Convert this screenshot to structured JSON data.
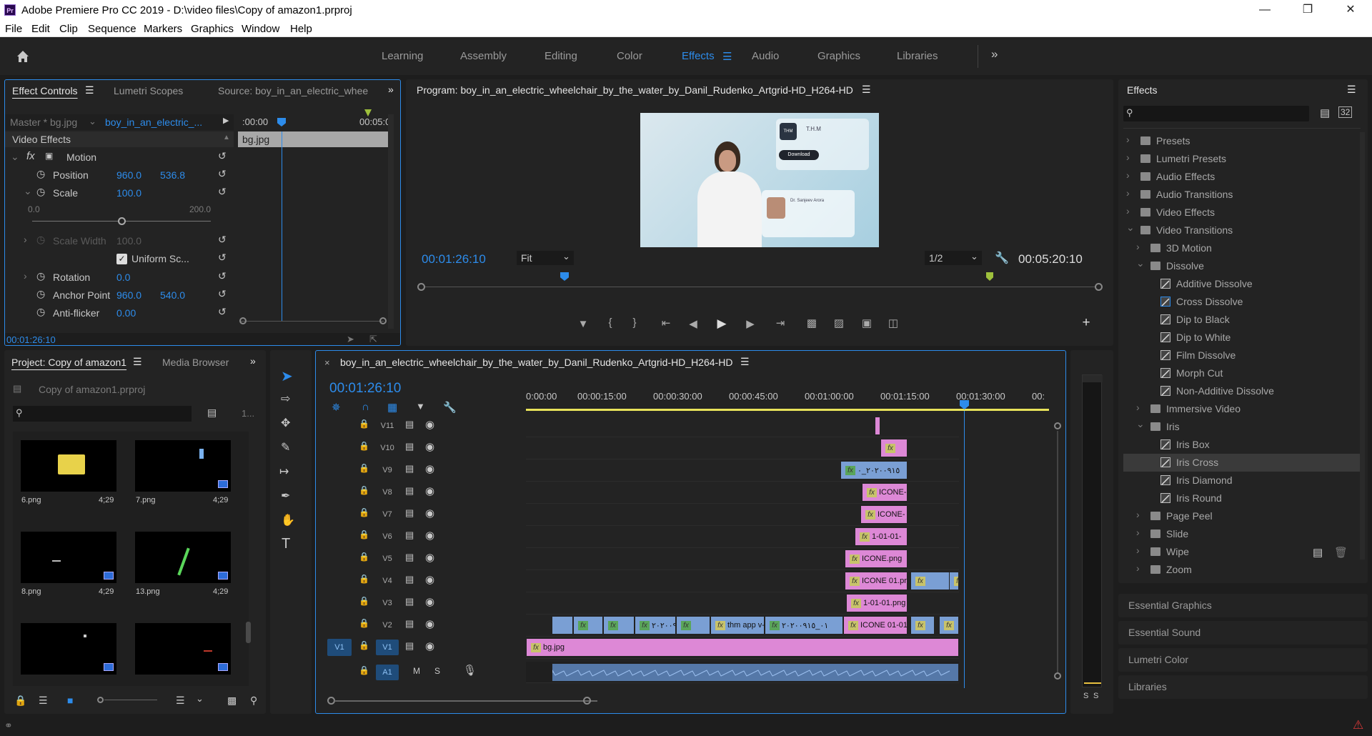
{
  "app": {
    "title": "Adobe Premiere Pro CC 2019 - D:\\video files\\Copy of amazon1.prproj",
    "logo": "Pr",
    "menu": [
      "File",
      "Edit",
      "Clip",
      "Sequence",
      "Markers",
      "Graphics",
      "Window",
      "Help"
    ],
    "window_controls": [
      "minimize-icon",
      "maximize-icon",
      "close-icon"
    ]
  },
  "workspaces": {
    "items": [
      "Learning",
      "Assembly",
      "Editing",
      "Color",
      "Effects",
      "Audio",
      "Graphics",
      "Libraries"
    ],
    "active": "Effects",
    "more": "»"
  },
  "effect_controls": {
    "tabs": [
      "Effect Controls",
      "Lumetri Scopes",
      "Source: boy_in_an_electric_whee"
    ],
    "master": "Master * bg.jpg",
    "clip": "boy_in_an_electric_...",
    "ruler_start": ":00:00",
    "ruler_end": "00:05:0",
    "clip_bar": "bg.jpg",
    "section": "Video Effects",
    "motion": "Motion",
    "props": {
      "position_label": "Position",
      "position_x": "960.0",
      "position_y": "536.8",
      "scale_label": "Scale",
      "scale_value": "100.0",
      "slider_min": "0.0",
      "slider_max": "200.0",
      "scale_width_label": "Scale Width",
      "scale_width_value": "100.0",
      "uniform_label": "Uniform Sc...",
      "rotation_label": "Rotation",
      "rotation_value": "0.0",
      "anchor_label": "Anchor Point",
      "anchor_x": "960.0",
      "anchor_y": "540.0",
      "flicker_label": "Anti-flicker",
      "flicker_value": "0.00"
    },
    "timecode": "00:01:26:10"
  },
  "program": {
    "title": "Program: boy_in_an_electric_wheelchair_by_the_water_by_Danil_Rudenko_Artgrid-HD_H264-HD",
    "timecode": "00:01:26:10",
    "fit": "Fit",
    "resolution": "1/2",
    "duration": "00:05:20:10",
    "frame": {
      "brand": "T.H.M",
      "download": "Download",
      "doctor": "Dr. Sanjeev Arora"
    }
  },
  "effects_panel": {
    "title": "Effects",
    "search_placeholder": "",
    "tree": [
      {
        "label": "Presets",
        "level": 0,
        "type": "folder",
        "open": false
      },
      {
        "label": "Lumetri Presets",
        "level": 0,
        "type": "folder",
        "open": false
      },
      {
        "label": "Audio Effects",
        "level": 0,
        "type": "folder",
        "open": false
      },
      {
        "label": "Audio Transitions",
        "level": 0,
        "type": "folder",
        "open": false
      },
      {
        "label": "Video Effects",
        "level": 0,
        "type": "folder",
        "open": false
      },
      {
        "label": "Video Transitions",
        "level": 0,
        "type": "folder",
        "open": true
      },
      {
        "label": "3D Motion",
        "level": 1,
        "type": "folder",
        "open": false
      },
      {
        "label": "Dissolve",
        "level": 1,
        "type": "folder",
        "open": true
      },
      {
        "label": "Additive Dissolve",
        "level": 2,
        "type": "fx"
      },
      {
        "label": "Cross Dissolve",
        "level": 2,
        "type": "fx",
        "default": true
      },
      {
        "label": "Dip to Black",
        "level": 2,
        "type": "fx"
      },
      {
        "label": "Dip to White",
        "level": 2,
        "type": "fx"
      },
      {
        "label": "Film Dissolve",
        "level": 2,
        "type": "fx"
      },
      {
        "label": "Morph Cut",
        "level": 2,
        "type": "fx"
      },
      {
        "label": "Non-Additive Dissolve",
        "level": 2,
        "type": "fx"
      },
      {
        "label": "Immersive Video",
        "level": 1,
        "type": "folder",
        "open": false
      },
      {
        "label": "Iris",
        "level": 1,
        "type": "folder",
        "open": true
      },
      {
        "label": "Iris Box",
        "level": 2,
        "type": "fx"
      },
      {
        "label": "Iris Cross",
        "level": 2,
        "type": "fx",
        "selected": true
      },
      {
        "label": "Iris Diamond",
        "level": 2,
        "type": "fx"
      },
      {
        "label": "Iris Round",
        "level": 2,
        "type": "fx"
      },
      {
        "label": "Page Peel",
        "level": 1,
        "type": "folder",
        "open": false
      },
      {
        "label": "Slide",
        "level": 1,
        "type": "folder",
        "open": false
      },
      {
        "label": "Wipe",
        "level": 1,
        "type": "folder",
        "open": false
      },
      {
        "label": "Zoom",
        "level": 1,
        "type": "folder",
        "open": false
      }
    ],
    "collapsed_panels": [
      "Essential Graphics",
      "Essential Sound",
      "Lumetri Color",
      "Libraries"
    ]
  },
  "project": {
    "tabs": [
      "Project: Copy of amazon1",
      "Media Browser"
    ],
    "file": "Copy of amazon1.prproj",
    "count": "1...",
    "items": [
      {
        "name": "6.png",
        "duration": "4;29"
      },
      {
        "name": "7.png",
        "duration": "4;29"
      },
      {
        "name": "8.png",
        "duration": "4;29"
      },
      {
        "name": "13.png",
        "duration": "4;29"
      },
      {
        "name": "",
        "duration": ""
      },
      {
        "name": "",
        "duration": ""
      }
    ]
  },
  "timeline": {
    "title": "boy_in_an_electric_wheelchair_by_the_water_by_Danil_Rudenko_Artgrid-HD_H264-HD",
    "timecode": "00:01:26:10",
    "ruler": [
      "0:00:00",
      "00:00:15:00",
      "00:00:30:00",
      "00:00:45:00",
      "00:01:00:00",
      "00:01:15:00",
      "00:01:30:00",
      "00:"
    ],
    "tracks": [
      "V11",
      "V10",
      "V9",
      "V8",
      "V7",
      "V6",
      "V5",
      "V4",
      "V3",
      "V2",
      "V1",
      "A1"
    ],
    "source_patch": "V1",
    "audio_buttons": [
      "M",
      "S"
    ],
    "clips": {
      "v9": "۰_٢٠٢٠٠٩١٥",
      "v8": "ICONE-",
      "v7": "ICONE-",
      "v6": "1-01-01-",
      "v5": "ICONE.png",
      "v4": "ICONE 01.pn",
      "v3": "1-01-01.png",
      "v2_a": "٢٠٢٠٠٩",
      "v2_b": "thm app v-",
      "v2_c": "٠١_٢٠٢٠٠٩١٥",
      "v2_d": "ICONE 01-01-",
      "v1": "bg.jpg"
    },
    "meter_labels": [
      "S",
      "S"
    ]
  },
  "colors": {
    "accent": "#2d8ceb",
    "video_clip": "#dd88d6",
    "graphic_clip": "#7a9fd4",
    "audio_clip": "#5578a8",
    "playhead": "#2d8ceb",
    "work_area": "#e8e25a"
  }
}
